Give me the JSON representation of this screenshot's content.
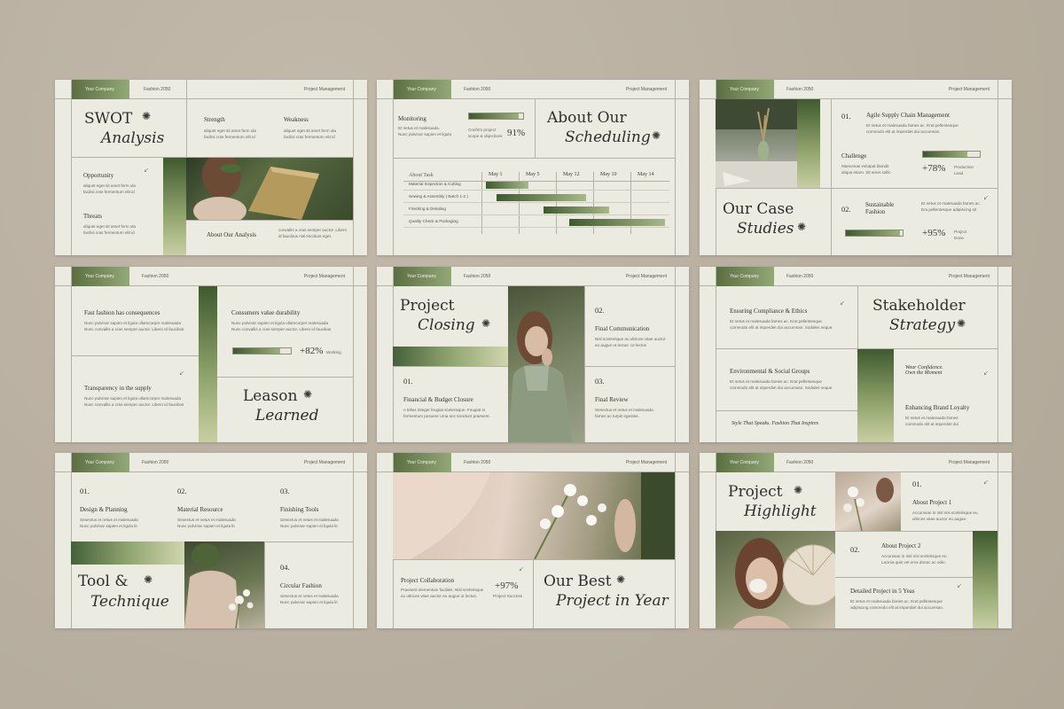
{
  "header": {
    "company": "Your Company",
    "edition": "Fashion 2050",
    "section": "Project Management"
  },
  "swot": {
    "title1": "SWOT",
    "title2": "Analysis",
    "strength": "Strength",
    "weakness": "Weakness",
    "opportunity": "Opportunity",
    "threats": "Threats",
    "about": "About Our Analysis",
    "body1": "aliquet eget sit amet ferm ula",
    "body2": "facilisi cras fermentum elit id",
    "body3": "convallis a cras semper auctor. Libero",
    "body4": "id faucibus nisl tincidunt eget."
  },
  "sched": {
    "title1": "About Our",
    "title2": "Scheduling",
    "monitoring": "Monitoring",
    "mon_text1": "Et netus et malesuada.",
    "mon_text2": "Nunc pulvinar sapien et ligula",
    "confirm1": "Confirm project",
    "confirm2": "scope & objectives",
    "pct": "91%",
    "progress": 0.91,
    "col_task": "About Task",
    "months": [
      "May 1",
      "May 5",
      "May 12",
      "May 10",
      "May 14"
    ],
    "tasks": [
      "Material Inspection & Cutting",
      "Sewing & Assembly ( Batch 1-2 )",
      "Finishing & Detailing",
      "Quality Check & Packaging"
    ]
  },
  "case": {
    "title1": "Our Case",
    "title2": "Studies",
    "n1": "01.",
    "t1": "Agile Supply Chain Management",
    "b1a": "Et netus et malesuada fames ac. Erat pellentesque",
    "b1b": "commodo elit at imperdiet dui accumsan.",
    "challenge": "Challenge",
    "ch1": "Maecenas volutpat blandit",
    "ch2": "aliqua etiam. Sit amet sollic",
    "pct1": "+78%",
    "lbl1a": "Production",
    "lbl1b": "Lead",
    "progress1": 0.78,
    "n2": "02.",
    "t2a": "Sustainable",
    "t2b": "Fashion",
    "b2a": "Et netus et malesuada fames ac.",
    "b2b": "Era pellentesque adipiscing sit",
    "pct2": "+95%",
    "lbl2a": "Project",
    "lbl2b": "Done",
    "progress2": 0.95
  },
  "lesson": {
    "t1": "Fast fashion has consequences",
    "b1": "Nunc pulvinar sapien et ligula ullamcorper malesuada",
    "b2": "Nunc convallis a cras semper auctor. Libero id faucibus",
    "t2": "Consumers value durability",
    "t3": "Transparency in the supply",
    "pct": "+82%",
    "lbl": "Working",
    "progress": 0.82,
    "title1": "Leason",
    "title2": "Learned"
  },
  "closing": {
    "title1": "Project",
    "title2": "Closing",
    "n1": "01.",
    "t1": "Financial & Budget Closure",
    "b1a": "n tellus integer feugiat scelerisque. Feugiat in",
    "b1b": "fermentum posuere urna nec tincidunt praesent.",
    "n2": "02.",
    "t2": "Final Communication",
    "b2a": "Nisl scelerisque eu ultrices vitae auctor",
    "b2b": "eu augue ut lectus. Ut lectus",
    "n3": "03.",
    "t3": "Final Review",
    "b3a": "Senectus et netus et malesuada",
    "b3b": "fames ac turpis egestas."
  },
  "stake": {
    "title1": "Stakeholder",
    "title2": "Strategy",
    "t1": "Ensuring Compliance & Ethics",
    "b1a": "Et netus et malesuada fames ac. Erat pellentesque",
    "b1b": "commodo elit at imperdiet dui accumsan. Sodales neque",
    "t2": "Environmental & Social Groups",
    "wear1": "Wear Confidence.",
    "wear2": "Own the Moment",
    "t3": "Enhancing Brand Loyalty",
    "b3a": "Et netus et malesuada fames",
    "b3b": "commodo elit at imperdiet dui",
    "tagline": "Style That Speaks. Fashion That Inspires"
  },
  "tools": {
    "n1": "01.",
    "t1": "Design & Planning",
    "n2": "02.",
    "t2": "Material Resource",
    "n3": "03.",
    "t3": "Finishing Tools",
    "b1": "Senectus et netus et malesuada",
    "b2": "Nunc pulvinar sapien et ligula lit",
    "title1": "Tool &",
    "title2": "Technique",
    "n4": "04.",
    "t4": "Circular Fashion",
    "b4a": "Senectus et netus et malesuada",
    "b4b": "Nunc pulvinar sapien et ligula lit"
  },
  "best": {
    "t1": "Project Collaboration",
    "b1a": "Praesent elementum facilisis. Nisl scelerisque",
    "b1b": "eu ultrices vitae auctor eu augue ut lectus.",
    "pct": "+97%",
    "lbl": "Project Success",
    "title1": "Our Best",
    "title2": "Project in Year"
  },
  "highlight": {
    "title1": "Project",
    "title2": "Highlight",
    "n1": "01.",
    "t1": "About Project 1",
    "b1a": "Accumsan in nisl nisi scelerisque eu",
    "b1b": "ultrices vitae auctor eu augue.",
    "n2": "02.",
    "t2": "About Project 2",
    "b2a": "Accumsan in nisl nisi scelerisque eu",
    "b2b": "Lacinia quis vel eros donec ac odio.",
    "t3": "Detailed Project in 5 Yeas",
    "b3a": "Et netus et malesuada fames ac. Erat pellentesque",
    "b3b": "adipiscing commodo elit at imperdiet dui accumsan."
  },
  "icons": {
    "star": "sparkle-icon",
    "arrow": "arrow-down-left-icon"
  }
}
